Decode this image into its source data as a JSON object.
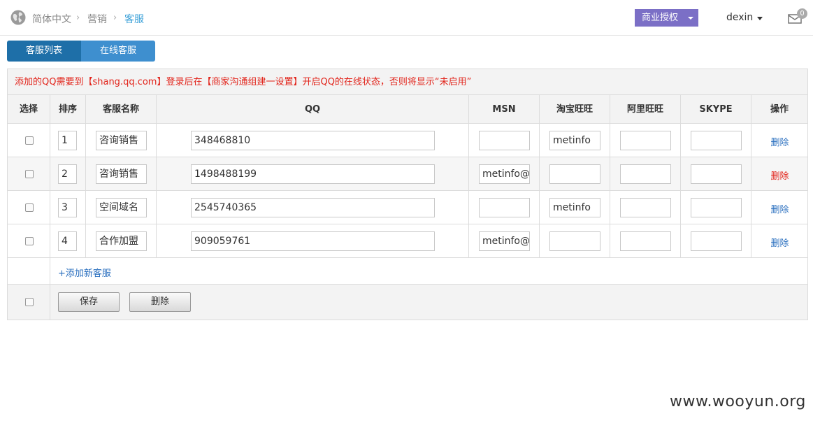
{
  "breadcrumb": {
    "icon": "globe-icon",
    "language": "简体中文",
    "section": "营销",
    "current": "客服"
  },
  "header": {
    "license_button": "商业授权",
    "username": "dexin",
    "mail_count": "0",
    "accent_color": "#7b6fc6"
  },
  "tabs": [
    {
      "label": "客服列表",
      "active": true
    },
    {
      "label": "在线客服",
      "active": false
    }
  ],
  "notice": "添加的QQ需要到【shang.qq.com】登录后在【商家沟通组建一设置】开启QQ的在线状态，否则将显示“未启用”",
  "table": {
    "headers": [
      "选择",
      "排序",
      "客服名称",
      "QQ",
      "MSN",
      "淘宝旺旺",
      "阿里旺旺",
      "SKYPE",
      "操作"
    ],
    "rows": [
      {
        "order": "1",
        "name": "咨询销售",
        "qq": "348468810",
        "msn": "",
        "taobao": "metinfo",
        "ali": "",
        "skype": "",
        "action": "删除"
      },
      {
        "order": "2",
        "name": "咨询销售",
        "qq": "1498488199",
        "msn": "metinfo@",
        "taobao": "",
        "ali": "",
        "skype": "",
        "action": "删除"
      },
      {
        "order": "3",
        "name": "空间域名",
        "qq": "2545740365",
        "msn": "",
        "taobao": "metinfo",
        "ali": "",
        "skype": "",
        "action": "删除"
      },
      {
        "order": "4",
        "name": "合作加盟",
        "qq": "909059761",
        "msn": "metinfo@",
        "taobao": "",
        "ali": "",
        "skype": "",
        "action": "删除"
      }
    ],
    "add_link": "+添加新客服"
  },
  "footer": {
    "save_label": "保存",
    "delete_label": "删除"
  },
  "watermark": "www.wooyun.org"
}
